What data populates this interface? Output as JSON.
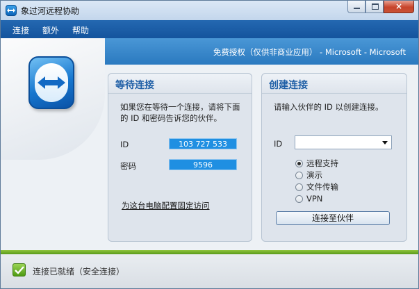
{
  "window": {
    "title": "象过河远程协助",
    "close_label": "×"
  },
  "menu": {
    "items": [
      "连接",
      "额外",
      "帮助"
    ]
  },
  "header": {
    "license": "免费授权（仅供非商业应用） - Microsoft - Microsoft"
  },
  "wait_panel": {
    "title": "等待连接",
    "description": "如果您在等待一个连接，请将下面的 ID 和密码告诉您的伙伴。",
    "id_label": "ID",
    "id_value": "103 727 533",
    "password_label": "密码",
    "password_value": "9596",
    "fixed_access_link": "为这台电脑配置固定访问"
  },
  "create_panel": {
    "title": "创建连接",
    "description": "请输入伙伴的 ID 以创建连接。",
    "id_label": "ID",
    "id_input_value": "",
    "options": [
      "远程支持",
      "演示",
      "文件传输",
      "VPN"
    ],
    "selected_option": "远程支持",
    "connect_button": "连接至伙伴"
  },
  "status": {
    "text": "连接已就绪（安全连接）",
    "indicator_color": "#5aa51b"
  },
  "colors": {
    "menu_bar": "#1a5ca6",
    "header_band": "#3a88cb",
    "accent_title": "#1f5fa6",
    "value_box": "#1f8fe2"
  }
}
